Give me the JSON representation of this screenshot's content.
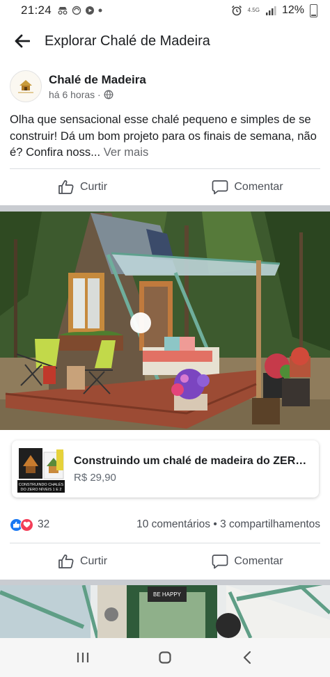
{
  "status_bar": {
    "time": "21:24",
    "network": "4.5G",
    "battery": "12%"
  },
  "header": {
    "title": "Explorar Chalé de Madeira",
    "back_icon": "arrow-left-icon"
  },
  "post": {
    "author": "Chalé de Madeira",
    "timestamp": "há 6 horas ·",
    "privacy_icon": "globe-icon",
    "text": "Olha que sensacional esse chalé pequeno e simples de se construir! Dá um bom projeto para os finais de semana, não é? Confira noss...",
    "see_more": "Ver mais"
  },
  "actions_top": {
    "like_label": "Curtir",
    "comment_label": "Comentar"
  },
  "product": {
    "title": "Construindo um chalé de madeira do ZERO!...",
    "price": "R$ 29,90",
    "thumb_lines": [
      "CONSTRUINDO CHALÉS",
      "DO ZERO NÍVEIS 1 E 2"
    ]
  },
  "reactions": {
    "count": "32",
    "comments": "10 comentários",
    "separator": "•",
    "shares": "3 compartilhamentos",
    "like_color": "#1877f2",
    "love_color": "#f33e58"
  },
  "actions_bottom": {
    "like_label": "Curtir",
    "comment_label": "Comentar"
  },
  "second_photo": {
    "sign_text": "BE HAPPY"
  },
  "nav_bar": {
    "recent_icon": "recent-apps-icon",
    "home_icon": "home-icon",
    "back_icon": "back-icon"
  }
}
